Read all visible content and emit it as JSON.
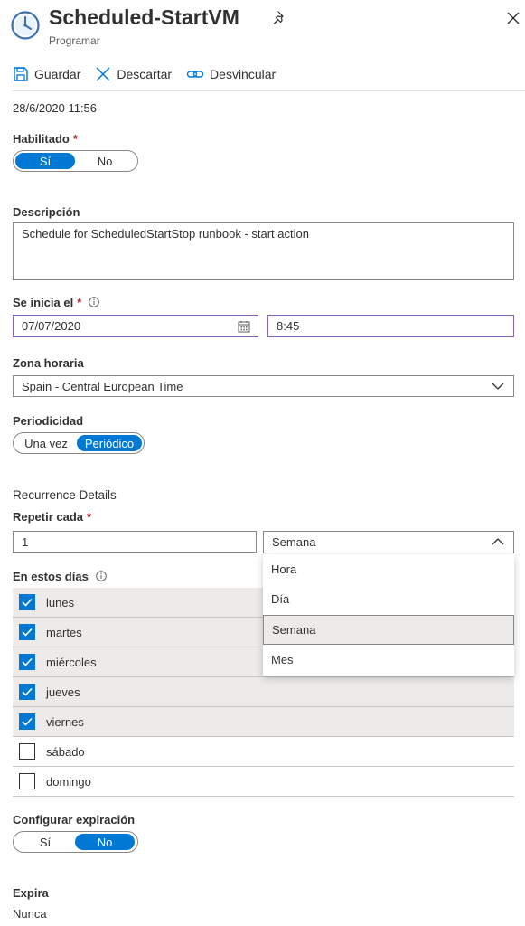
{
  "header": {
    "title": "Scheduled-StartVM",
    "subtitle": "Programar"
  },
  "toolbar": {
    "save_label": "Guardar",
    "discard_label": "Descartar",
    "unlink_label": "Desvincular"
  },
  "datetime": "28/6/2020 11:56",
  "enabled": {
    "label": "Habilitado",
    "required_mark": "*",
    "options": [
      "Sí",
      "No"
    ],
    "selected": "Sí"
  },
  "description": {
    "label": "Descripción",
    "value": "Schedule for ScheduledStartStop runbook - start action"
  },
  "start": {
    "label": "Se inicia el",
    "required_mark": "*",
    "date_value": "07/07/2020",
    "time_value": "8:45"
  },
  "timezone": {
    "label": "Zona horaria",
    "value": "Spain - Central European Time"
  },
  "recurrence": {
    "label": "Periodicidad",
    "options": [
      "Una vez",
      "Periódico"
    ],
    "selected": "Periódico"
  },
  "recurrence_details": {
    "heading": "Recurrence Details",
    "repeat_label": "Repetir cada",
    "required_mark": "*",
    "repeat_value": "1",
    "unit_value": "Semana",
    "unit_options": [
      "Hora",
      "Día",
      "Semana",
      "Mes"
    ]
  },
  "days": {
    "label": "En estos días",
    "items": [
      {
        "label": "lunes",
        "checked": true
      },
      {
        "label": "martes",
        "checked": true
      },
      {
        "label": "miércoles",
        "checked": true
      },
      {
        "label": "jueves",
        "checked": true
      },
      {
        "label": "viernes",
        "checked": true
      },
      {
        "label": "sábado",
        "checked": false
      },
      {
        "label": "domingo",
        "checked": false
      }
    ]
  },
  "expiration": {
    "label": "Configurar expiración",
    "options": [
      "Sí",
      "No"
    ],
    "selected": "No"
  },
  "expires": {
    "label": "Expira",
    "value": "Nunca"
  },
  "colors": {
    "accent": "#0078d4",
    "focus_border": "#8764b8",
    "required": "#a4262c"
  }
}
